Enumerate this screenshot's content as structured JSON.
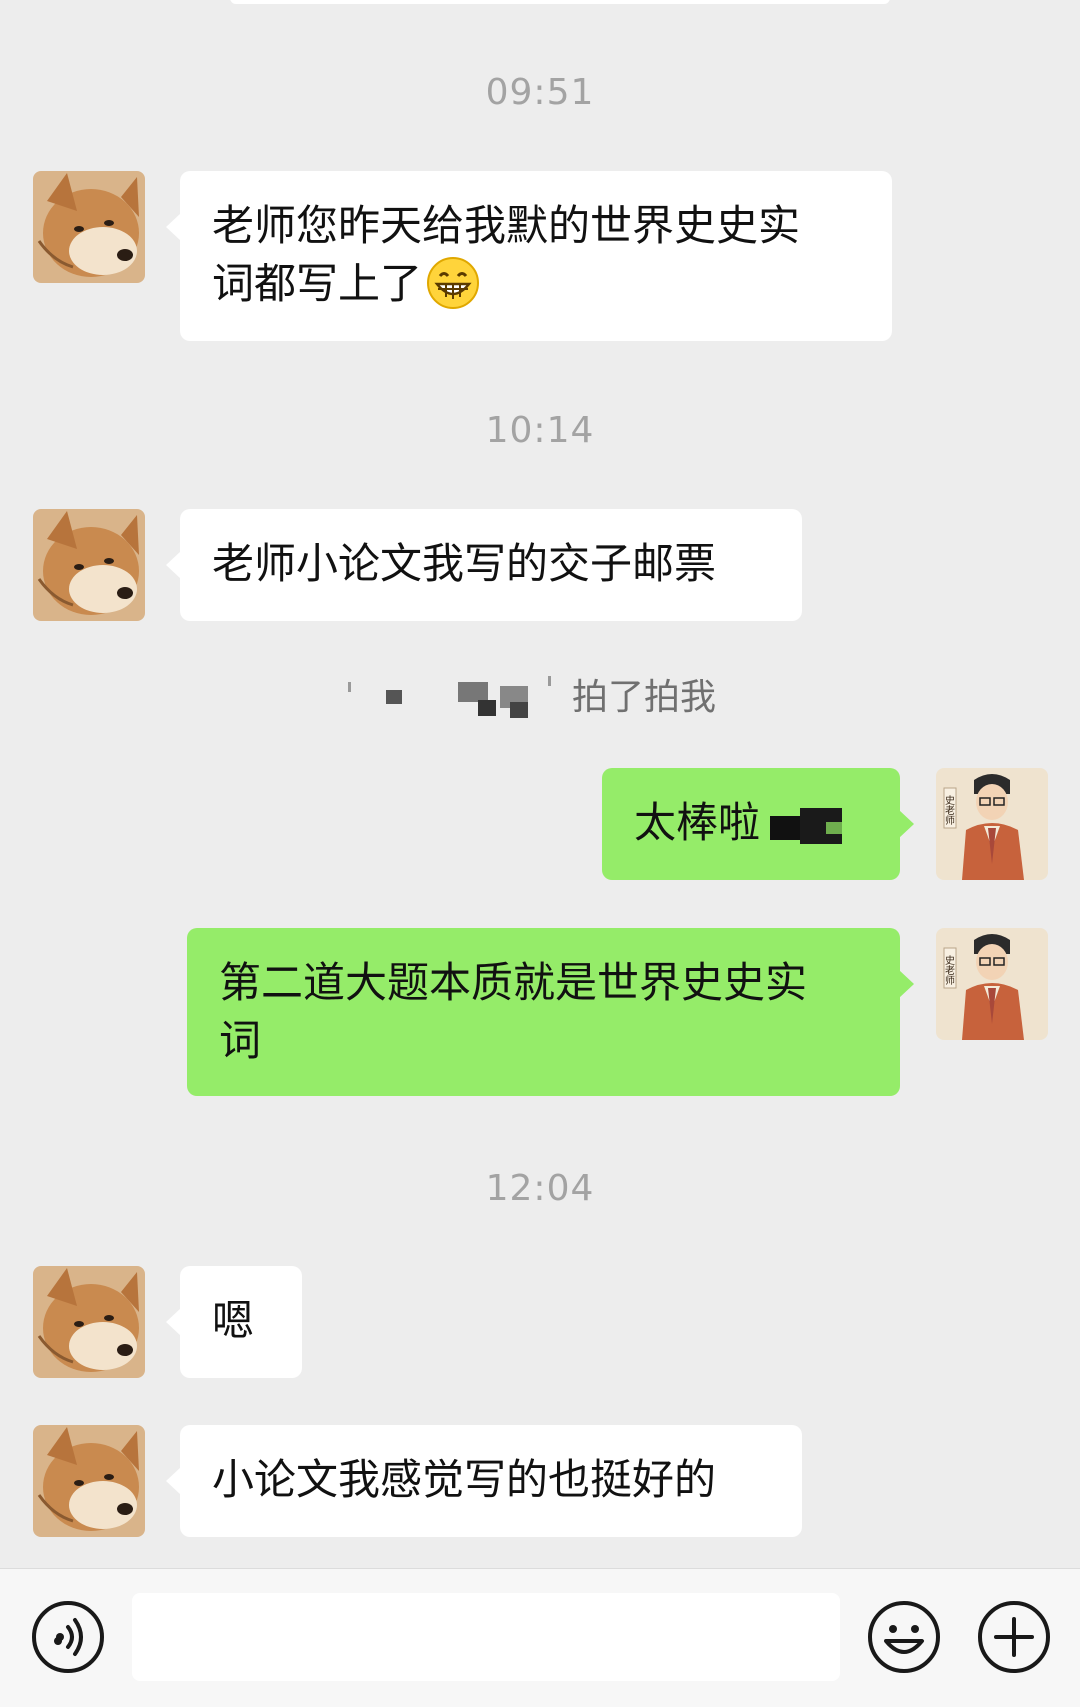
{
  "timestamps": [
    "09:51",
    "10:14",
    "12:04"
  ],
  "messages": {
    "m1_line1": "老师您昨天给我默的世界史史实",
    "m1_line2": "词都写上了",
    "m1_emoji": "grinning-face-emoji",
    "m2": "老师小论文我写的交子邮票",
    "pat": "拍了拍我",
    "m3": "太棒啦",
    "m4_line1": "第二道大题本质就是世界史史实",
    "m4_line2": "词",
    "m5": "嗯",
    "m6": "小论文我感觉写的也挺好的"
  },
  "avatars": {
    "student": "shiba-inu-avatar",
    "teacher": "teacher-illustration-avatar",
    "teacher_badge": "史老师"
  },
  "input_bar": {
    "voice_icon": "voice-icon",
    "emoji_icon": "emoji-icon",
    "plus_icon": "plus-icon",
    "input_value": ""
  },
  "colors": {
    "background": "#ededed",
    "received_bubble": "#ffffff",
    "sent_bubble": "#95ec69",
    "timestamp_text": "#a3a3a3"
  }
}
